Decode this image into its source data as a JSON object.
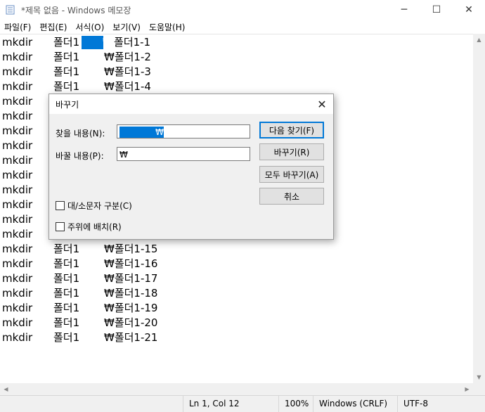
{
  "window": {
    "title": "*제목 없음 - Windows 메모장",
    "minimize_glyph": "─",
    "maximize_glyph": "☐",
    "close_glyph": "✕"
  },
  "menu": [
    "파일(F)",
    "편집(E)",
    "서식(O)",
    "보기(V)",
    "도움말(H)"
  ],
  "lines": [
    [
      "mkdir",
      "폴더1",
      "폴더1-1"
    ],
    [
      "mkdir",
      "폴더1",
      "₩폴더1-2"
    ],
    [
      "mkdir",
      "폴더1",
      "₩폴더1-3"
    ],
    [
      "mkdir",
      "폴더1",
      "₩폴더1-4"
    ],
    [
      "mkdir",
      "",
      ""
    ],
    [
      "mkdir",
      "",
      ""
    ],
    [
      "mkdir",
      "",
      ""
    ],
    [
      "mkdir",
      "",
      ""
    ],
    [
      "mkdir",
      "",
      ""
    ],
    [
      "mkdir",
      "",
      ""
    ],
    [
      "mkdir",
      "",
      ""
    ],
    [
      "mkdir",
      "",
      ""
    ],
    [
      "mkdir",
      "",
      ""
    ],
    [
      "mkdir",
      "",
      ""
    ],
    [
      "mkdir",
      "폴더1",
      "₩폴더1-15"
    ],
    [
      "mkdir",
      "폴더1",
      "₩폴더1-16"
    ],
    [
      "mkdir",
      "폴더1",
      "₩폴더1-17"
    ],
    [
      "mkdir",
      "폴더1",
      "₩폴더1-18"
    ],
    [
      "mkdir",
      "폴더1",
      "₩폴더1-19"
    ],
    [
      "mkdir",
      "폴더1",
      "₩폴더1-20"
    ],
    [
      "mkdir",
      "폴더1",
      "₩폴더1-21"
    ]
  ],
  "selected_text": "₩",
  "dialog": {
    "title": "바꾸기",
    "close_glyph": "✕",
    "find_label": "찾을 내용(N):",
    "find_value": "₩",
    "replace_label": "바꿀 내용(P):",
    "replace_value": "₩",
    "find_next": "다음 찾기(F)",
    "replace": "바꾸기(R)",
    "replace_all": "모두 바꾸기(A)",
    "cancel": "취소",
    "match_case": "대/소문자 구분(C)",
    "wrap_around": "주위에 배치(R)"
  },
  "status": {
    "position": "Ln 1, Col 12",
    "zoom": "100%",
    "line_ending": "Windows (CRLF)",
    "encoding": "UTF-8"
  }
}
